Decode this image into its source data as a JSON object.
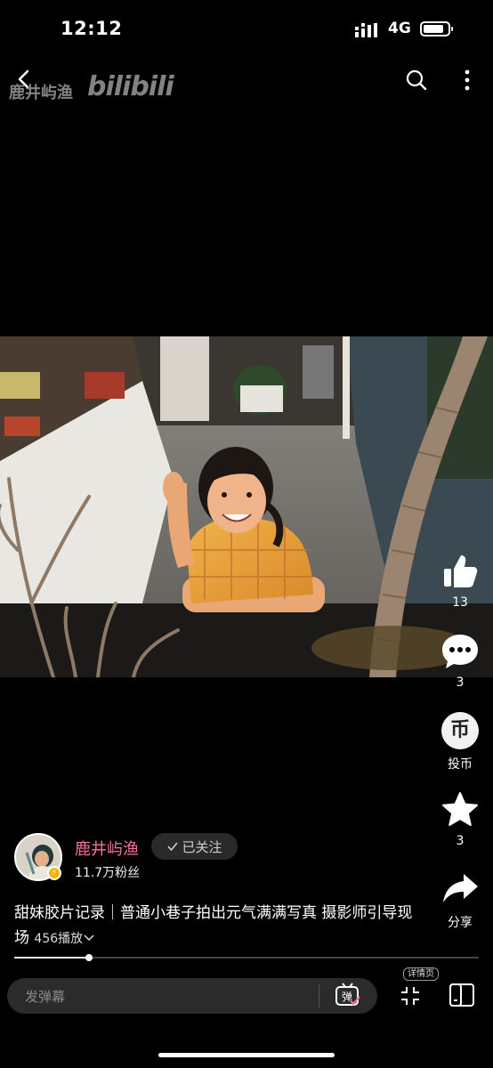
{
  "status": {
    "time": "12:12",
    "network": "4G"
  },
  "watermark": {
    "author": "鹿井屿渔",
    "logo": "bilibili"
  },
  "icons": {
    "back": "back-arrow-icon",
    "search": "search-icon",
    "more": "more-vertical-icon",
    "like": "thumbs-up-icon",
    "comment": "comment-bubble-icon",
    "coin": "coin-icon",
    "favorite": "star-icon",
    "share": "share-arrow-icon",
    "danmu": "danmu-toggle-icon",
    "fullscreen": "fullscreen-icon",
    "portrait": "portrait-mode-icon",
    "verified": "lightning-badge-icon"
  },
  "actions": {
    "like_count": "13",
    "comment_count": "3",
    "coin_glyph": "币",
    "coin_label": "投币",
    "favorite_count": "3",
    "share_label": "分享"
  },
  "author": {
    "name": "鹿井屿渔",
    "fans": "11.7万粉丝",
    "follow_label": "已关注"
  },
  "video": {
    "title": "甜妹胶片记录｜普通小巷子拍出元气满满写真 摄影师引导现场",
    "plays": "456播放"
  },
  "progress": {
    "fraction": 0.16
  },
  "bottom": {
    "danmu_placeholder": "发弹幕",
    "danmu_glyph": "弹",
    "detail_tag": "详情页"
  },
  "colors": {
    "accent": "#fb7299",
    "background": "#000000"
  }
}
